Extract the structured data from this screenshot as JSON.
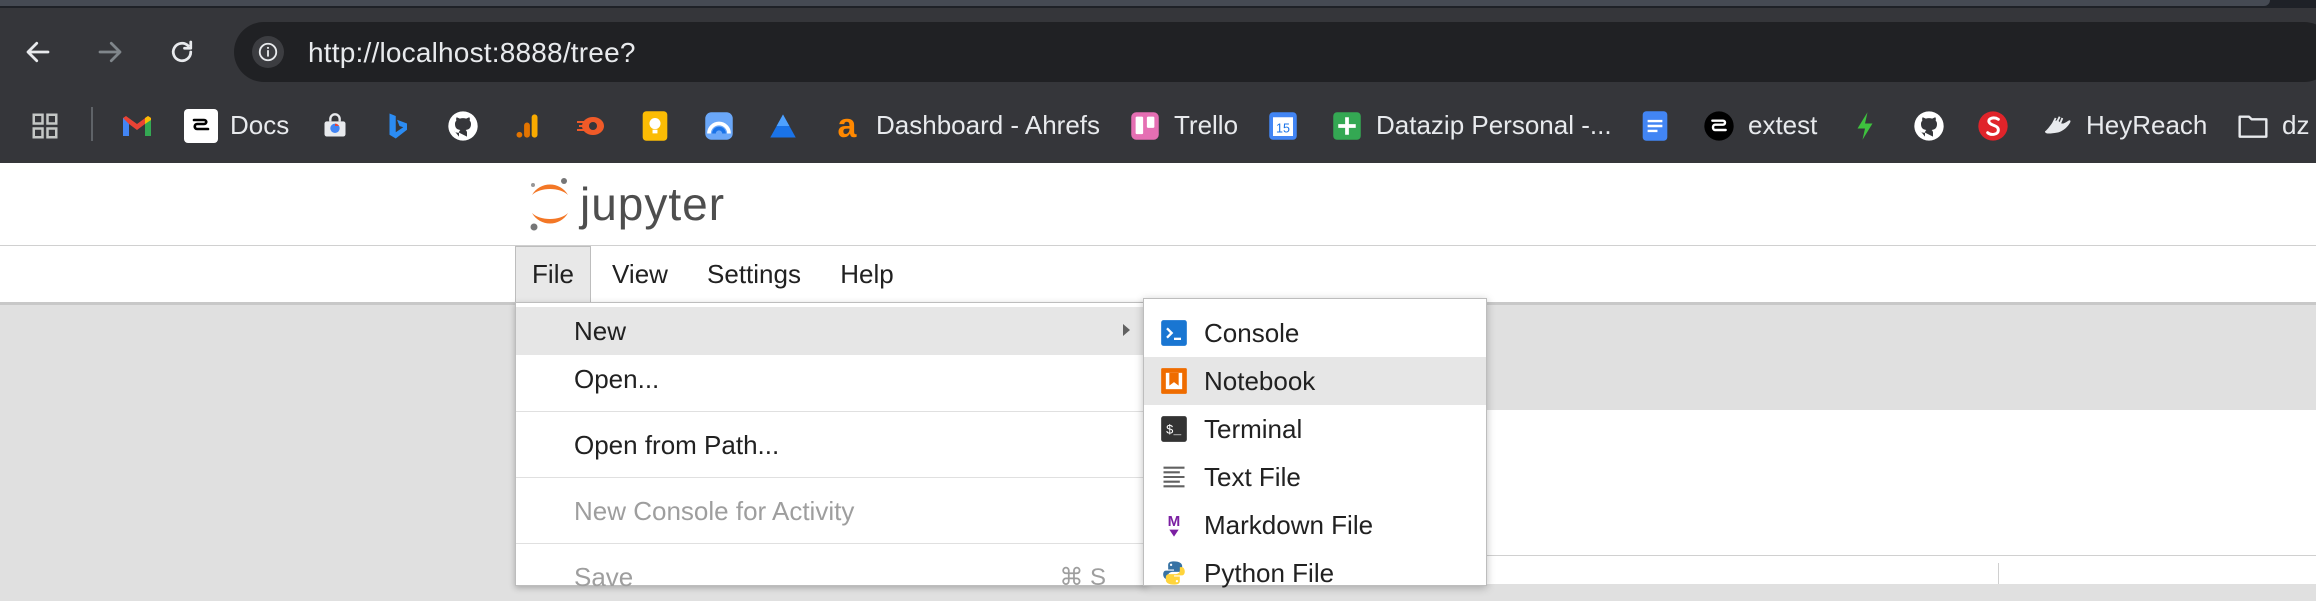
{
  "browser": {
    "url": "http://localhost:8888/tree?",
    "bookmarks": [
      {
        "icon": "apps-grid-icon",
        "label": ""
      },
      {
        "icon": "gmail-icon",
        "label": ""
      },
      {
        "icon": "docs-icon",
        "label": "Docs"
      },
      {
        "icon": "web-store-icon",
        "label": ""
      },
      {
        "icon": "bing-icon",
        "label": ""
      },
      {
        "icon": "github-icon",
        "label": ""
      },
      {
        "icon": "analytics-icon",
        "label": ""
      },
      {
        "icon": "orange-logo-icon",
        "label": ""
      },
      {
        "icon": "keep-icon",
        "label": ""
      },
      {
        "icon": "rainbow-icon",
        "label": ""
      },
      {
        "icon": "drive-triangle-icon",
        "label": ""
      },
      {
        "icon": "ahrefs-icon",
        "label": "Dashboard - Ahrefs"
      },
      {
        "icon": "trello-icon",
        "label": "Trello"
      },
      {
        "icon": "calendar-icon",
        "label": ""
      },
      {
        "icon": "sheets-icon",
        "label": "Datazip Personal -..."
      },
      {
        "icon": "google-docs-icon",
        "label": ""
      },
      {
        "icon": "extest-icon",
        "label": "extest"
      },
      {
        "icon": "bolt-icon",
        "label": ""
      },
      {
        "icon": "github-icon",
        "label": ""
      },
      {
        "icon": "s-logo-icon",
        "label": ""
      },
      {
        "icon": "heyreach-icon",
        "label": "HeyReach"
      },
      {
        "icon": "folder-icon",
        "label": "dz"
      }
    ]
  },
  "jupyter": {
    "logo_text": "jupyter",
    "menus": [
      "File",
      "View",
      "Settings",
      "Help"
    ]
  },
  "file_menu": {
    "items": [
      {
        "label": "New",
        "state": "highlighted",
        "has_submenu": true
      },
      {
        "label": "Open...",
        "state": "normal"
      },
      {
        "label": "Open from Path...",
        "state": "normal"
      },
      {
        "label": "New Console for Activity",
        "state": "disabled"
      },
      {
        "label": "Save",
        "state": "disabled",
        "shortcut": "⌘ S"
      }
    ]
  },
  "new_submenu": {
    "items": [
      {
        "label": "Console",
        "icon": "console-icon"
      },
      {
        "label": "Notebook",
        "icon": "notebook-icon",
        "state": "highlighted"
      },
      {
        "label": "Terminal",
        "icon": "terminal-icon"
      },
      {
        "label": "Text File",
        "icon": "text-file-icon"
      },
      {
        "label": "Markdown File",
        "icon": "markdown-file-icon"
      },
      {
        "label": "Python File",
        "icon": "python-file-icon"
      }
    ]
  },
  "colors": {
    "chrome_bg": "#35363a",
    "omnibox_bg": "#202124",
    "jupyter_orange": "#f37726",
    "console_blue": "#1976d2",
    "markdown_purple": "#7b1fa2"
  }
}
